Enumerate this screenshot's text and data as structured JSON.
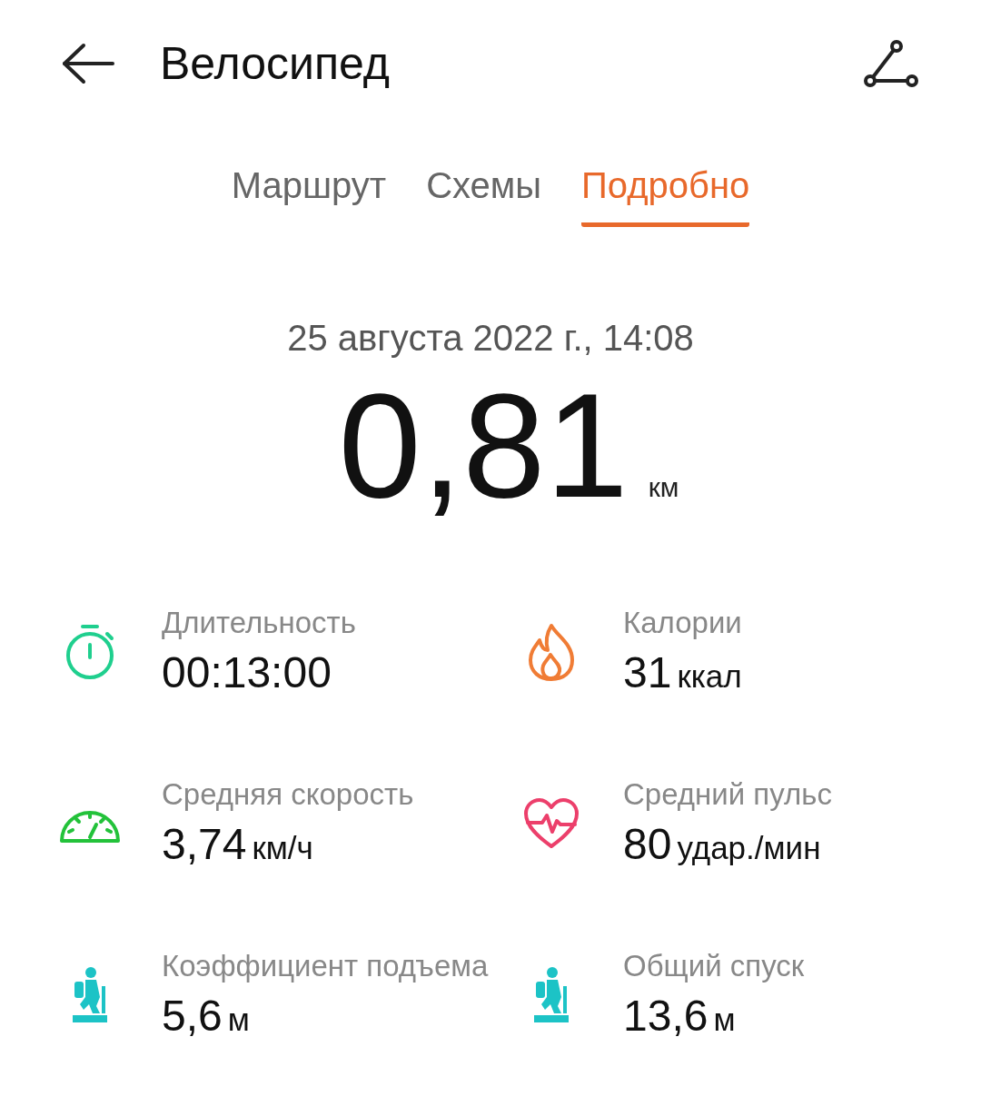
{
  "header": {
    "title": "Велосипед"
  },
  "tabs": [
    {
      "label": "Маршрут",
      "selected": false
    },
    {
      "label": "Схемы",
      "selected": false
    },
    {
      "label": "Подробно",
      "selected": true
    }
  ],
  "date": "25 августа 2022 г., 14:08",
  "distance": {
    "value": "0,81",
    "unit": "км"
  },
  "stats": [
    {
      "kind": "duration",
      "label": "Длительность",
      "value": "00:13:00"
    },
    {
      "kind": "calories",
      "label": "Калории",
      "value": "31",
      "unit": "ккал"
    },
    {
      "kind": "speed",
      "label": "Средняя скорость",
      "value": "3,74",
      "unit": "км/ч"
    },
    {
      "kind": "pulse",
      "label": "Средний пульс",
      "value": "80",
      "unit": "удар./мин"
    },
    {
      "kind": "climb",
      "label": "Коэффициент подъема",
      "value": "5,6",
      "unit": "м"
    },
    {
      "kind": "descent",
      "label": "Общий спуск",
      "value": "13,6",
      "unit": "м"
    }
  ]
}
